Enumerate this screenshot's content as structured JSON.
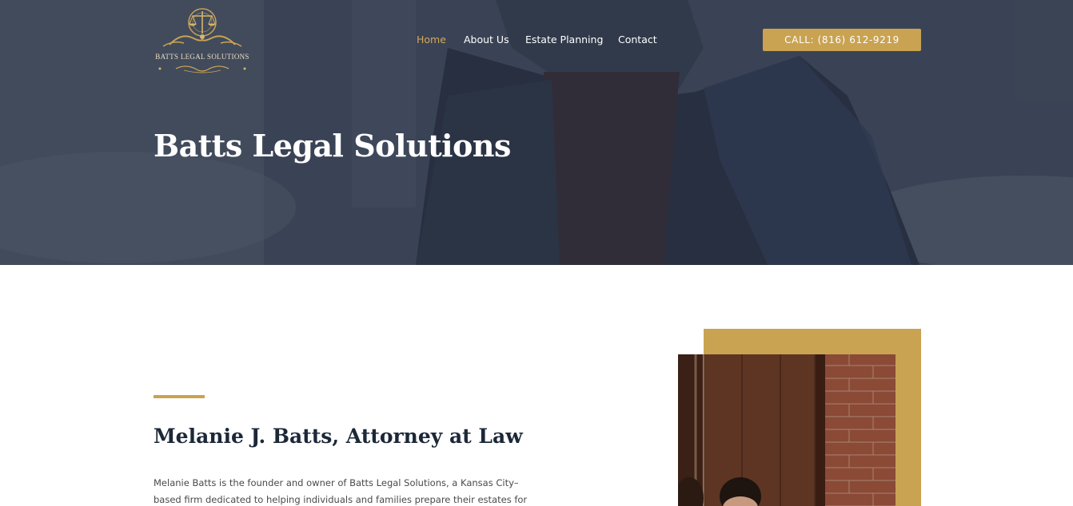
{
  "header": {
    "logo_text": "BATTS LEGAL SOLUTIONS",
    "nav": [
      {
        "label": "Home",
        "active": true
      },
      {
        "label": "About Us",
        "active": false
      },
      {
        "label": "Estate Planning",
        "active": false
      },
      {
        "label": "Contact",
        "active": false
      }
    ],
    "call_button": "CALL: (816) 612-9219"
  },
  "hero": {
    "title": "Batts Legal Solutions"
  },
  "about": {
    "heading": "Melanie J. Batts, Attorney at Law",
    "bio_line1": "Melanie Batts is the founder and owner of Batts Legal Solutions, a Kansas City–",
    "bio_line2": "based firm dedicated to helping individuals and families prepare their estates for"
  },
  "colors": {
    "accent_gold": "#c9a352",
    "nav_active": "#d4a85a",
    "heading_navy": "#1c2838",
    "hero_overlay": "#2b3445"
  }
}
